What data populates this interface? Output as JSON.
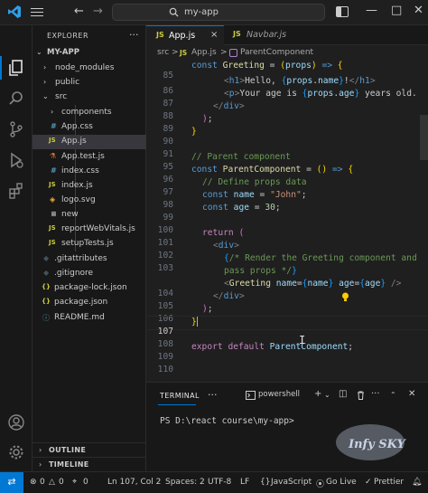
{
  "titlebar": {
    "search_text": "my-app",
    "back_icon": "arrow-left-icon",
    "forward_icon": "arrow-right-icon"
  },
  "sidebar": {
    "title": "EXPLORER",
    "more": "···",
    "root": "MY-APP",
    "items": [
      {
        "label": "node_modules",
        "type": "folder",
        "color": "#cccccc"
      },
      {
        "label": "public",
        "type": "folder",
        "color": "#cccccc"
      },
      {
        "label": "src",
        "type": "folder-open",
        "color": "#cccccc"
      },
      {
        "label": "components",
        "type": "folder",
        "color": "#cccccc"
      },
      {
        "label": "App.css",
        "type": "css",
        "icon": "#",
        "color": "#cccccc"
      },
      {
        "label": "App.js",
        "type": "js",
        "icon": "JS",
        "color": "#cccccc"
      },
      {
        "label": "App.test.js",
        "type": "test",
        "icon": "⚗",
        "color": "#cccccc"
      },
      {
        "label": "index.css",
        "type": "css",
        "icon": "#",
        "color": "#cccccc"
      },
      {
        "label": "index.js",
        "type": "js",
        "icon": "JS",
        "color": "#cccccc"
      },
      {
        "label": "logo.svg",
        "type": "svg",
        "icon": "◈",
        "color": "#cccccc"
      },
      {
        "label": "new",
        "type": "file",
        "icon": "≡",
        "color": "#cccccc"
      },
      {
        "label": "reportWebVitals.js",
        "type": "js",
        "icon": "JS",
        "color": "#cccccc"
      },
      {
        "label": "setupTests.js",
        "type": "js",
        "icon": "JS",
        "color": "#cccccc"
      },
      {
        "label": ".gitattributes",
        "type": "git",
        "icon": "◆",
        "color": "#cccccc"
      },
      {
        "label": ".gitignore",
        "type": "git",
        "icon": "◆",
        "color": "#cccccc"
      },
      {
        "label": "package-lock.json",
        "type": "json",
        "icon": "{}",
        "color": "#cccccc"
      },
      {
        "label": "package.json",
        "type": "json",
        "icon": "{}",
        "color": "#cccccc"
      },
      {
        "label": "README.md",
        "type": "info",
        "icon": "ⓘ",
        "color": "#cccccc"
      }
    ],
    "outline": "OUTLINE",
    "timeline": "TIMELINE"
  },
  "tabs": [
    {
      "js": "JS",
      "name": "App.js",
      "close": "×",
      "active": true
    },
    {
      "js": "JS",
      "name": "Navbar.js",
      "active": false
    }
  ],
  "breadcrumb": [
    "src",
    ">",
    "JS",
    "App.js",
    ">",
    "ParentComponent"
  ],
  "editor": {
    "top_line_code": "const Greeting = (props) => {",
    "lines": [
      {
        "no": "86",
        "code": "<h1>Hello, {props.name}!</h1>"
      },
      {
        "no": "87",
        "code": "<p>Your age is {props.age} years old."
      },
      {
        "no": "88",
        "code": "</div>"
      },
      {
        "no": "89",
        "code": ");"
      },
      {
        "no": "90",
        "code": "}"
      },
      {
        "no": "91",
        "code": ""
      },
      {
        "no": "95",
        "code": "// Parent component"
      },
      {
        "no": "96",
        "code": "const ParentComponent = () => {"
      },
      {
        "no": "97",
        "code": "// Define props data"
      },
      {
        "no": "98",
        "code": "const name = \"John\";"
      },
      {
        "no": "99",
        "code": "const age = 30;"
      },
      {
        "no": "100",
        "code": ""
      },
      {
        "no": "101",
        "code": "return ("
      },
      {
        "no": "102",
        "code": "<div>"
      },
      {
        "no": "103",
        "code": "{/* Render the Greeting component and"
      },
      {
        "no": "",
        "code": "pass props */}"
      },
      {
        "no": "104",
        "code": "<Greeting name={name} age={age} />"
      },
      {
        "no": "105",
        "code": "</div>"
      },
      {
        "no": "106",
        "code": ");"
      },
      {
        "no": "107",
        "code": "}"
      },
      {
        "no": "108",
        "code": ""
      },
      {
        "no": "109",
        "code": "export default ParentComponent;"
      },
      {
        "no": "110",
        "code": ""
      }
    ],
    "current_line": "107"
  },
  "panel": {
    "tab": "TERMINAL",
    "more": "···",
    "shell": "powershell",
    "prompt": "PS D:\\react course\\my-app>",
    "watermark": "Infy SKY"
  },
  "status": {
    "remote": "⇄",
    "errors": "0",
    "warnings": "0",
    "ports": "0",
    "cursor": "Ln 107, Col 2",
    "spaces": "Spaces: 2",
    "encoding": "UTF-8",
    "eol": "LF",
    "language": "JavaScript",
    "golive": "Go Live",
    "prettier": "Prettier"
  },
  "colors": {
    "accent": "#0078d4",
    "js_badge": "#cbcb41"
  }
}
